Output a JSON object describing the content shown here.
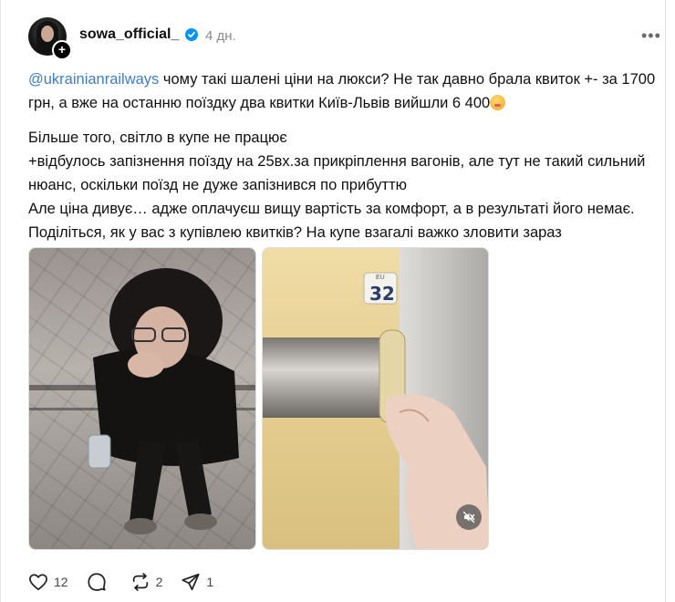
{
  "post": {
    "username": "sowa_official_",
    "time": "4 дн.",
    "more_label": "•••",
    "avatar_badge": "+",
    "paragraphs": {
      "p1": {
        "mention": "@ukrainianrailways",
        "text": " чому такі шалені ціни на люкси? Не так давно брала квиток +- за 1700 грн, а вже на останню поїздку два квитки Київ-Львів вийшли 6 400"
      },
      "p2": {
        "line1": "Більше того, світло в купе не працює",
        "line2": "+відбулось запізнення поїзду на 25вх.за прикріплення вагонів, але тут не такий сильний нюанс, оскільки поїзд не дуже запізнився по прибуттю",
        "line3": "Але ціна дивує… адже оплачуєш вищу вартість за комфорт, а в результаті його немає. Поділіться, як у вас з купівлею квитків? На купе взагалі важко зловити зараз"
      }
    },
    "photo2_sign": "32",
    "photo2_sign_small": "EU"
  },
  "actions": {
    "likes": "12",
    "comments": "",
    "reposts": "2",
    "shares": "1"
  },
  "colors": {
    "mention": "#3c7fc8",
    "verified": "#0095f6",
    "muted_text": "#8a8a8a"
  },
  "icons": [
    "plus-icon",
    "verified-icon",
    "more-icon",
    "mute-icon",
    "heart-icon",
    "comment-icon",
    "repost-icon",
    "share-icon"
  ]
}
